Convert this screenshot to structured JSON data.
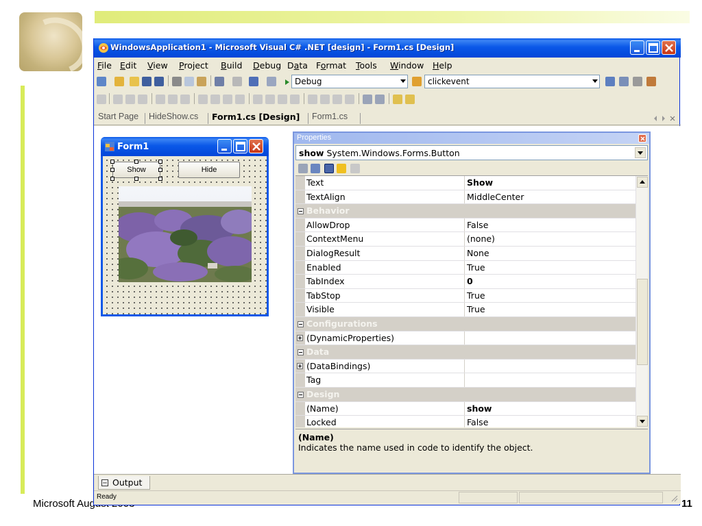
{
  "slide": {
    "footer_left": "Microsoft August 2003",
    "page_number": "11"
  },
  "window": {
    "title": "WindowsApplication1 - Microsoft Visual C# .NET [design] - Form1.cs [Design]"
  },
  "menu": [
    "File",
    "Edit",
    "View",
    "Project",
    "Build",
    "Debug",
    "Data",
    "Format",
    "Tools",
    "Window",
    "Help"
  ],
  "toolbar": {
    "config_combo": "Debug",
    "find_combo": "clickevent"
  },
  "doc_tabs": [
    "Start Page",
    "HideShow.cs",
    "Form1.cs [Design]",
    "Form1.cs"
  ],
  "form1": {
    "title": "Form1",
    "show_button": "Show",
    "hide_button": "Hide"
  },
  "properties": {
    "title": "Properties",
    "object_name": "show",
    "object_type": "System.Windows.Forms.Button",
    "rows": [
      {
        "name": "Text",
        "value": "Show",
        "bold": true
      },
      {
        "name": "TextAlign",
        "value": "MiddleCenter"
      },
      {
        "category": "Behavior"
      },
      {
        "name": "AllowDrop",
        "value": "False"
      },
      {
        "name": "ContextMenu",
        "value": "(none)"
      },
      {
        "name": "DialogResult",
        "value": "None"
      },
      {
        "name": "Enabled",
        "value": "True"
      },
      {
        "name": "TabIndex",
        "value": "0",
        "bold": true
      },
      {
        "name": "TabStop",
        "value": "True"
      },
      {
        "name": "Visible",
        "value": "True"
      },
      {
        "category": "Configurations"
      },
      {
        "name": "(DynamicProperties)",
        "value": "",
        "expandable": true
      },
      {
        "category": "Data"
      },
      {
        "name": "(DataBindings)",
        "value": "",
        "expandable": true
      },
      {
        "name": "Tag",
        "value": ""
      },
      {
        "category": "Design"
      },
      {
        "name": "(Name)",
        "value": "show",
        "bold": true
      },
      {
        "name": "Locked",
        "value": "False"
      }
    ],
    "description_title": "(Name)",
    "description_text": "Indicates the name used in code to identify the object."
  },
  "output_tab": "Output",
  "status": "Ready",
  "colors": {
    "xp_blue": "#0a58e8",
    "chrome": "#ece9d8",
    "slide_accent": "#d8eb5a"
  }
}
